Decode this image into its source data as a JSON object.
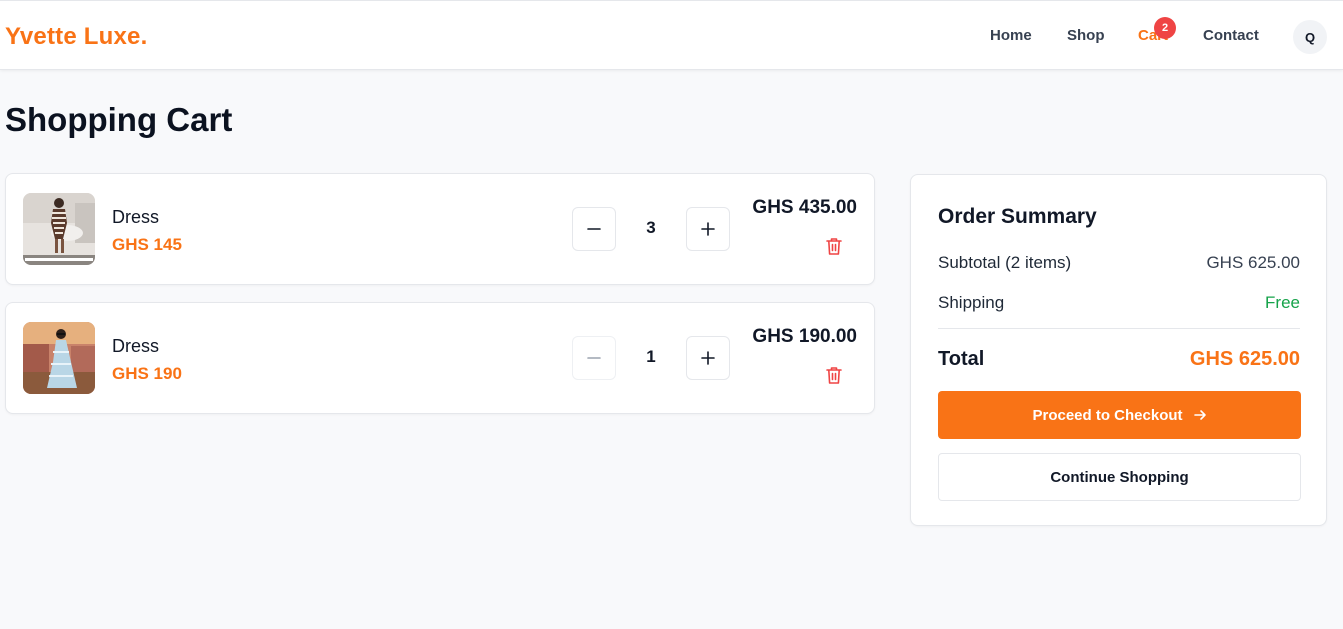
{
  "header": {
    "logo": "Yvette Luxe.",
    "nav": {
      "home": "Home",
      "shop": "Shop",
      "cart": "Cart",
      "contact": "Contact"
    },
    "cart_count": "2",
    "avatar_initial": "Q"
  },
  "page": {
    "title": "Shopping Cart"
  },
  "cart": {
    "items": [
      {
        "name": "Dress",
        "unit_price": "GHS 145",
        "quantity": "3",
        "line_total": "GHS 435.00",
        "thumb_icon": "dress-photo-1",
        "minus_disabled": false
      },
      {
        "name": "Dress",
        "unit_price": "GHS 190",
        "quantity": "1",
        "line_total": "GHS 190.00",
        "thumb_icon": "dress-photo-2",
        "minus_disabled": true
      }
    ]
  },
  "summary": {
    "title": "Order Summary",
    "subtotal_label": "Subtotal (2 items)",
    "subtotal_value": "GHS 625.00",
    "shipping_label": "Shipping",
    "shipping_value": "Free",
    "total_label": "Total",
    "total_value": "GHS 625.00",
    "checkout_label": "Proceed to Checkout",
    "continue_label": "Continue Shopping"
  },
  "colors": {
    "accent": "#f97316",
    "badge": "#ef4444",
    "free": "#16a34a",
    "delete": "#ef4444"
  }
}
